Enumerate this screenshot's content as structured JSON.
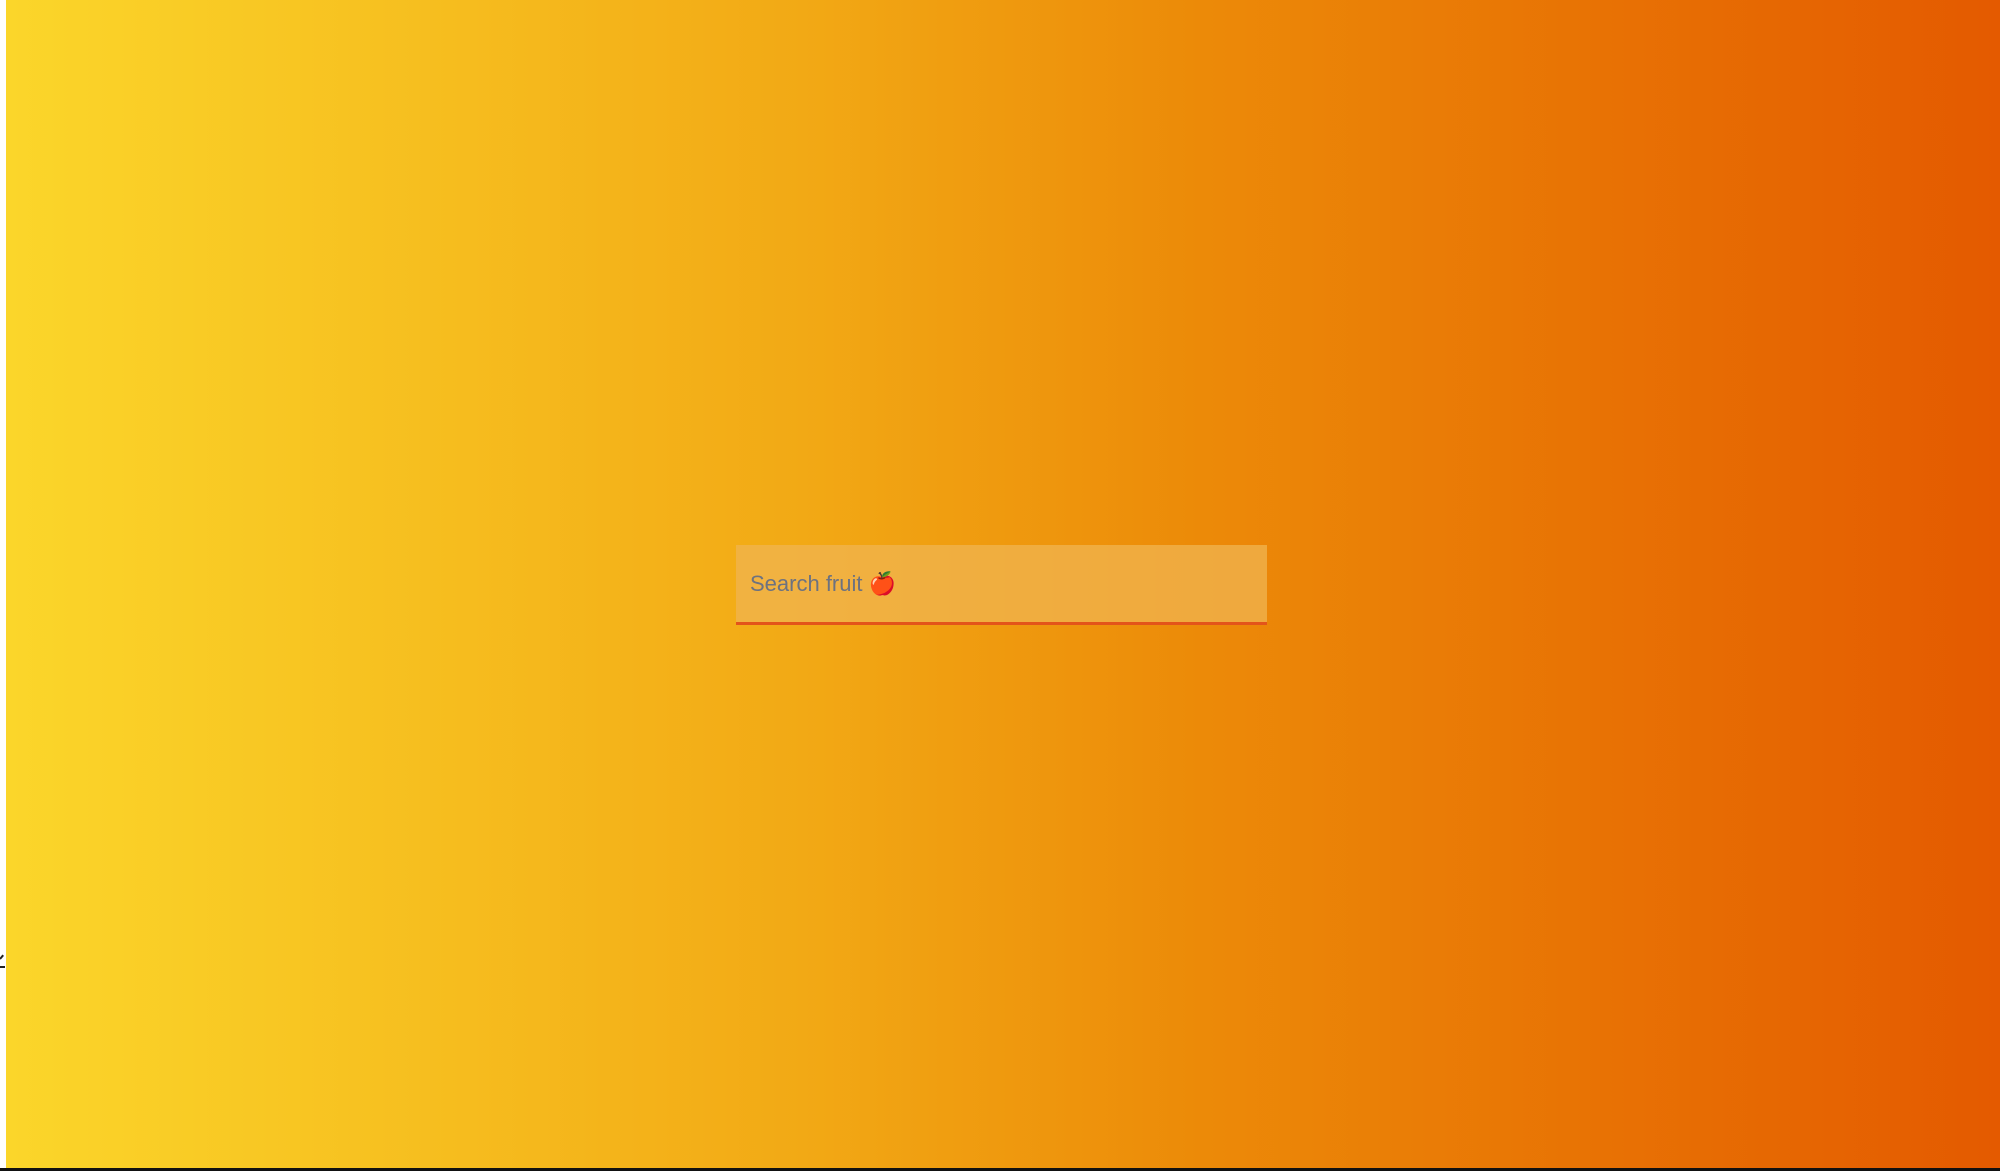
{
  "search": {
    "placeholder": "Search fruit 🍎",
    "value": ""
  },
  "colors": {
    "gradient_start": "#fbd62a",
    "gradient_end": "#e45a00",
    "input_underline": "#e3541a",
    "placeholder_text": "#6d7280"
  }
}
